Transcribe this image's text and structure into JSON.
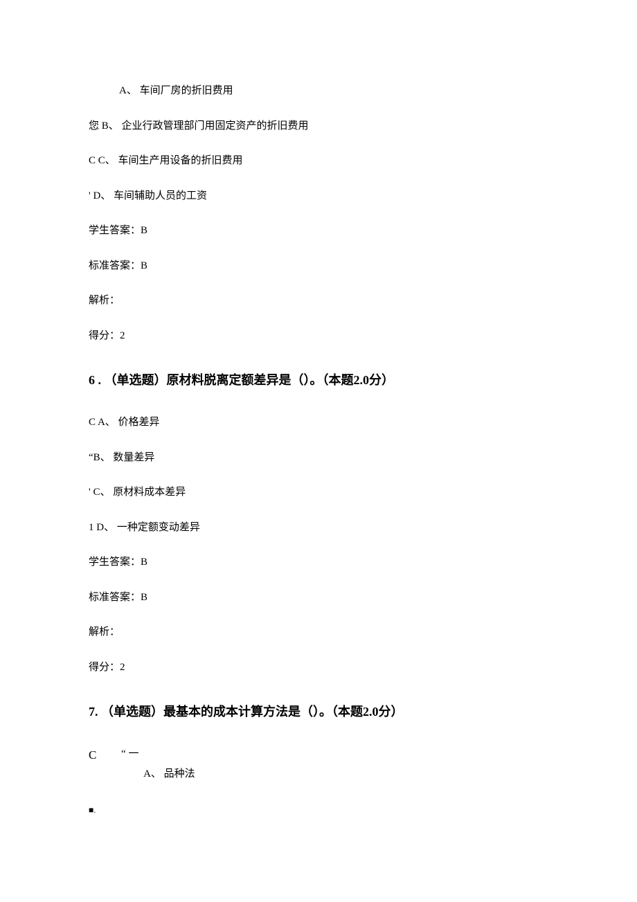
{
  "q5": {
    "optA_prefix": "",
    "optA": "A、 车间厂房的折旧费用",
    "optB_prefix": "您 ",
    "optB": "B、 企业行政管理部门用固定资产的折旧费用",
    "optC_prefix": "C ",
    "optC": "C、 车间生产用设备的折旧费用",
    "optD_prefix": "' ",
    "optD": "D、 车间辅助人员的工资",
    "student": "学生答案：B",
    "standard": "标准答案：B",
    "analysis": "解析：",
    "score": "得分：2"
  },
  "q6": {
    "title": "6 . （单选题）原材料脱离定额差异是（）。（本题2.0分）",
    "optA_prefix": "C ",
    "optA": "A、 价格差异",
    "optB_prefix": "“",
    "optB": "B、 数量差异",
    "optC_prefix": "' ",
    "optC": "C、 原材料成本差异",
    "optD_prefix": "1 ",
    "optD": "D、 一种定额变动差异",
    "student": "学生答案：B",
    "standard": "标准答案：B",
    "analysis": "解析：",
    "score": "得分：2"
  },
  "q7": {
    "title": "7. （单选题）最基本的成本计算方法是（）。（本题2.0分）",
    "prefixC": "C",
    "firstLine": "“ 一",
    "optA": "A、 品种法",
    "square": "■."
  }
}
